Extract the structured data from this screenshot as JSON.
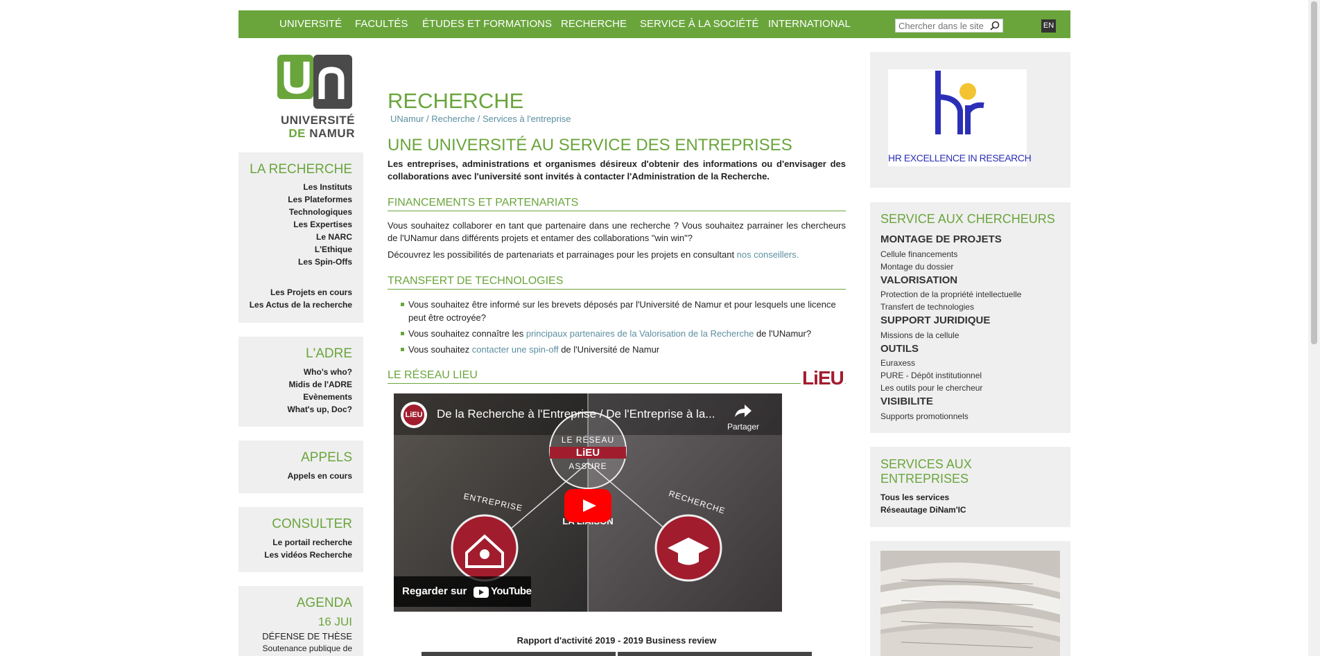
{
  "nav": {
    "items": [
      "UNIVERSITÉ",
      "FACULTÉS",
      "ÉTUDES ET FORMATIONS",
      "RECHERCHE",
      "SERVICE À LA SOCIÉTÉ",
      "INTERNATIONAL"
    ],
    "search_placeholder": "Chercher dans le site",
    "lang": "EN"
  },
  "logo": {
    "line1": "UNIVERSITÉ",
    "line2_de": "DE",
    "line2_namur": "NAMUR",
    "color_green": "#6aa53c",
    "color_dark": "#4a4a4a"
  },
  "left": {
    "recherche": {
      "title": "LA RECHERCHE",
      "links": [
        "Les Instituts",
        "Les Plateformes",
        "Technologiques",
        "Les Expertises",
        "Le NARC",
        "L'Ethique",
        "Les Spin-Offs",
        "Les Projets en cours",
        "Les Actus de la recherche"
      ]
    },
    "adre": {
      "title": "L'ADRE",
      "links": [
        "Who's who?",
        "Midis de l'ADRE",
        "Evènements",
        "What's up, Doc?"
      ]
    },
    "appels": {
      "title": "APPELS",
      "links": [
        "Appels en cours"
      ]
    },
    "consulter": {
      "title": "CONSULTER",
      "links": [
        "Le portail recherche",
        "Les vidéos Recherche"
      ]
    },
    "agenda": {
      "title": "AGENDA",
      "date": "16 JUI",
      "event": "DÉFENSE DE THÈSE",
      "desc": "Soutenance publique de"
    }
  },
  "main": {
    "title": "RECHERCHE",
    "breadcrumb": {
      "home": "UNamur",
      "sep": " / ",
      "section": "Recherche",
      "page": "Services à l'entreprise"
    },
    "heading": "UNE UNIVERSITÉ AU SERVICE DES ENTREPRISES",
    "intro": "Les entreprises, administrations et organismes désireux d'obtenir des informations ou d'envisager des collaborations avec l'université sont invités à contacter l'Administration de la Recherche.",
    "fin": {
      "title": "FINANCEMENTS ET PARTENARIATS",
      "p1": "Vous souhaitez collaborer en tant que partenaire dans une recherche ? Vous souhaitez parrainer les chercheurs de l'UNamur dans différents projets et entamer des collaborations \"win win\"?",
      "p2_text": "Découvrez les possibilités de partenariats et parrainages pour les projets en consultant ",
      "p2_link": "nos conseillers."
    },
    "transfert": {
      "title": "TRANSFERT DE TECHNOLOGIES",
      "b1": "Vous souhaitez être informé sur les brevets déposés par l'Université de Namur et pour lesquels une licence peut être octroyée?",
      "b2_pre": "Vous souhaitez connaître les ",
      "b2_link": "principaux partenaires de la Valorisation de la Recherche",
      "b2_post": " de l'UNamur?",
      "b3_pre": "Vous souhaitez ",
      "b3_link": "contacter une spin-off",
      "b3_post": " de l'Université de Namur"
    },
    "lieu": {
      "title": "LE RÉSEAU LIEU",
      "logo": "LiEU",
      "video_title": "De la Recherche à l'Entreprise / De l'Entreprise à la...",
      "share": "Partager",
      "watch": "Regarder sur",
      "youtube": "YouTube",
      "center_top": "LE RÉSEAU",
      "center_logo": "LiEU",
      "center_bottom": "ASSURE",
      "liaison": "LA LIAISON",
      "entreprise": "ENTREPRISE",
      "recherche": "RECHERCHE"
    },
    "rapport": "Rapport d'activité 2019 - 2019 Business review"
  },
  "right": {
    "hr": {
      "text": "HR EXCELLENCE IN RESEARCH",
      "color": "#2b2fb7"
    },
    "service": {
      "title": "SERVICE AUX CHERCHEURS",
      "groups": [
        {
          "title": "MONTAGE DE PROJETS",
          "links": [
            "Cellule financements",
            "Montage du dossier"
          ]
        },
        {
          "title": "VALORISATION",
          "links": [
            "Protection de la propriété intellectuelle",
            "Transfert de technologies"
          ]
        },
        {
          "title": "SUPPORT JURIDIQUE",
          "links": [
            "Missions de la cellule"
          ]
        },
        {
          "title": "OUTILS",
          "links": [
            "Euraxess",
            "PURE - Dépôt institutionnel",
            "Les outils pour le chercheur"
          ]
        },
        {
          "title": "VISIBILITE",
          "links": [
            "Supports promotionnels"
          ]
        }
      ]
    },
    "entreprises": {
      "title": "SERVICES AUX ENTREPRISES",
      "links": [
        "Tous les services",
        "Réseautage DiNam'IC"
      ]
    }
  },
  "colors": {
    "accent": "#6aa53c",
    "link": "#5b8fa0",
    "panel": "#efefef"
  }
}
